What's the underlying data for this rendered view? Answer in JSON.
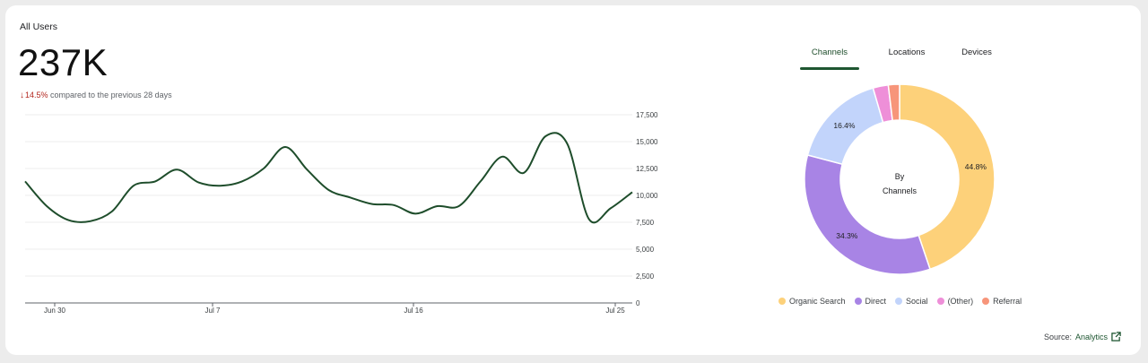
{
  "header": {
    "title": "All Users",
    "value": "237K",
    "delta_arrow": "↓",
    "delta_pct": "14.5%",
    "delta_text": " compared to the previous 28 days"
  },
  "chart_data": [
    {
      "type": "line",
      "x_tick_labels": [
        "Jun 30",
        "Jul 7",
        "Jul 16",
        "Jul 25"
      ],
      "ylim": [
        0,
        17500
      ],
      "y_tick_labels": [
        "17,500",
        "15,000",
        "12,500",
        "10,000",
        "7,500",
        "5,000",
        "2,500",
        "0"
      ],
      "series": [
        {
          "color": "#1e4d2b",
          "values": [
            11300,
            9000,
            7700,
            7600,
            8500,
            10900,
            11300,
            12400,
            11200,
            10900,
            11300,
            12500,
            14500,
            12400,
            10500,
            9800,
            9200,
            9100,
            8300,
            9000,
            9000,
            11300,
            13600,
            12100,
            15500,
            14800,
            7800,
            8800,
            10300
          ]
        }
      ],
      "grid": true
    },
    {
      "type": "pie",
      "center_label": [
        "By",
        "Channels"
      ],
      "slices": [
        {
          "label": "Organic Search",
          "value": 44.8,
          "color": "#fdd17a",
          "show_label": "44.8%"
        },
        {
          "label": "Direct",
          "value": 34.3,
          "color": "#a884e5",
          "show_label": "34.3%"
        },
        {
          "label": "Social",
          "value": 16.4,
          "color": "#c2d4fb",
          "show_label": "16.4%"
        },
        {
          "label": "(Other)",
          "value": 2.6,
          "color": "#ee8fd8",
          "show_label": ""
        },
        {
          "label": "Referral",
          "value": 1.9,
          "color": "#f7957a",
          "show_label": ""
        }
      ]
    }
  ],
  "tabs": [
    {
      "label": "Channels",
      "active": true
    },
    {
      "label": "Locations",
      "active": false
    },
    {
      "label": "Devices",
      "active": false
    }
  ],
  "legend": [
    {
      "label": "Organic Search",
      "color": "#fdd17a"
    },
    {
      "label": "Direct",
      "color": "#a884e5"
    },
    {
      "label": "Social",
      "color": "#c2d4fb"
    },
    {
      "label": "(Other)",
      "color": "#ee8fd8"
    },
    {
      "label": "Referral",
      "color": "#f7957a"
    }
  ],
  "source": {
    "prefix": "Source:",
    "link": "Analytics",
    "icon": "external-link-icon"
  }
}
